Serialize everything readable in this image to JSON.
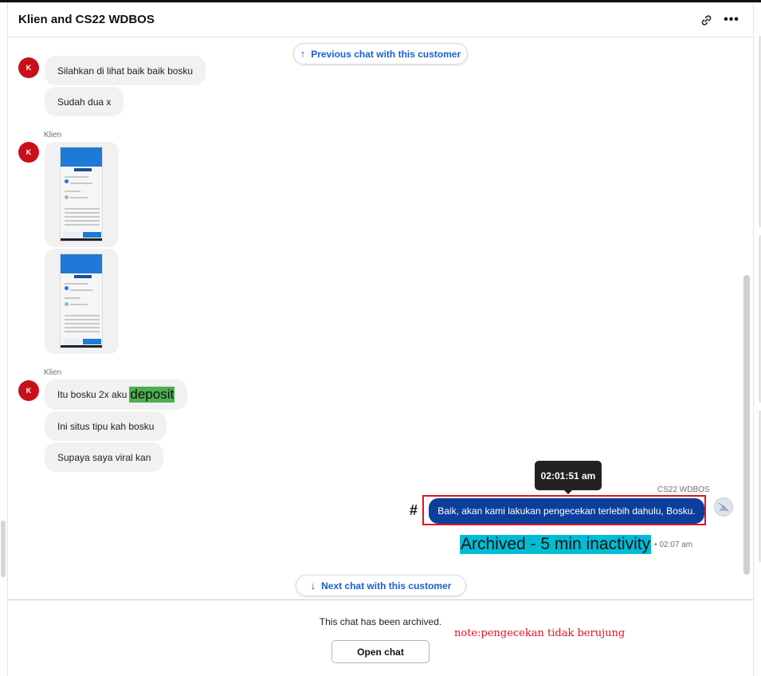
{
  "header": {
    "title": "Klien and CS22 WDBOS",
    "link_icon": "link-icon",
    "more_icon": "more-horizontal-icon",
    "more_glyph": "•••"
  },
  "nav": {
    "previous_label": "Previous chat with this customer",
    "previous_arrow": "↑",
    "next_label": "Next chat with this customer",
    "next_arrow": "↓"
  },
  "messages": {
    "customer_initial": "K",
    "sender_name": "Klien",
    "group1": [
      "Silahkan di lihat baik baik bosku",
      "Sudah dua x"
    ],
    "group3_first": "Itu bosku 2x aku",
    "group3_highlight": "deposit",
    "group3_rest": [
      "Ini situs tipu kah bosku",
      "Supaya saya viral kan"
    ]
  },
  "agent": {
    "name": "CS22 WDBOS",
    "tooltip_time": "02:01:51 am",
    "hash": "#",
    "message": "Baik, akan kami lakukan pengecekan terlebih dahulu, Bosku.",
    "status_highlight": "Archived - 5 min inactivity",
    "status_time": "• 02:07 am"
  },
  "footer": {
    "archived_text": "This chat has been archived.",
    "open_chat_label": "Open chat",
    "note": "note:pengecekan tidak berujung"
  },
  "colors": {
    "accent_blue": "#1a5fd1",
    "agent_bubble": "#0c3f9b",
    "customer_avatar": "#c8101a",
    "note_red": "#e5121c",
    "highlight_green": "#4caf50",
    "highlight_cyan": "#00bcd4"
  }
}
